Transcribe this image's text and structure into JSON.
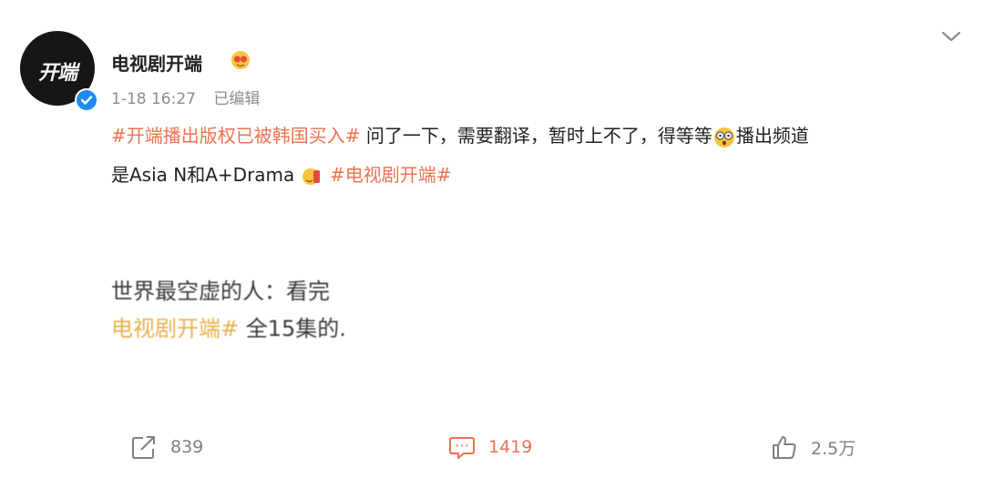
{
  "user": {
    "name": "电视剧开端",
    "avatar_text": "开端",
    "verified_color": "#1e8cf0"
  },
  "post": {
    "time": "1-18 16:27",
    "edited": "已编辑",
    "tag1": "#开端播出版权已被韩国买入#",
    "text1": "问了一下，需要翻译，暂时上不了，得等等",
    "text2": "播出频道",
    "text3": "是Asia N和A+Drama",
    "tag2": "#电视剧开端#"
  },
  "embedded_comment": {
    "line1": "世界最空虚的人：看完",
    "tag": "电视剧开端#",
    "line2_rest": " 全15集的."
  },
  "actions": {
    "share_count": "839",
    "comment_count": "1419",
    "like_count": "2.5万"
  },
  "colors": {
    "accent": "#eb7350",
    "muted": "#808080"
  },
  "icons": [
    "chevron-down-icon",
    "share-icon",
    "comment-icon",
    "like-icon",
    "verified-icon"
  ]
}
